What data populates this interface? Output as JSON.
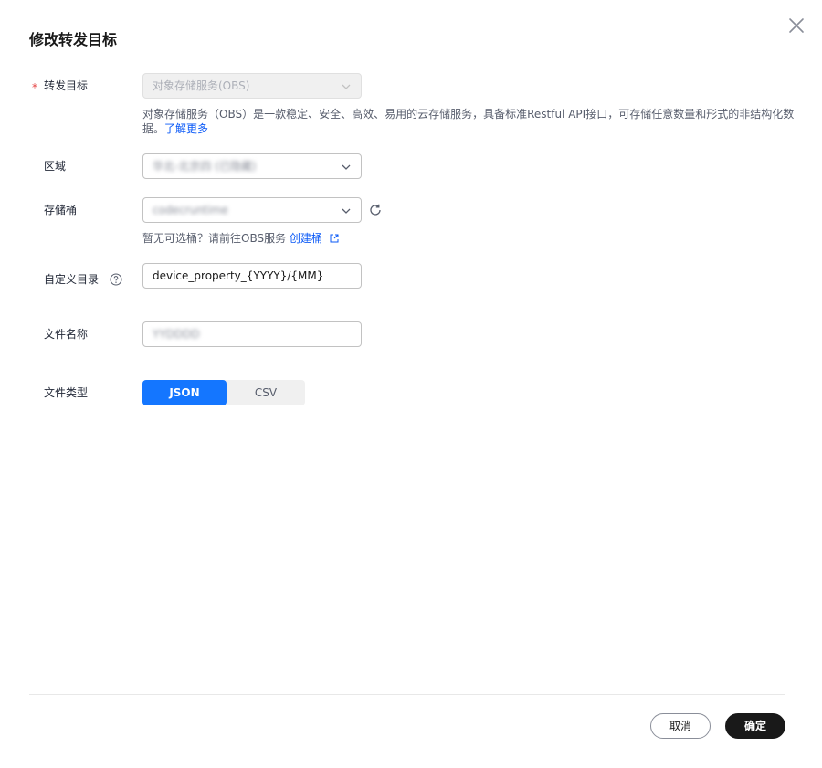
{
  "dialog": {
    "title": "修改转发目标"
  },
  "form": {
    "target": {
      "required_mark": "*",
      "label": "转发目标",
      "value": "对象存储服务(OBS)",
      "description": "对象存储服务（OBS）是一款稳定、安全、高效、易用的云存储服务，具备标准Restful API接口，可存储任意数量和形式的非结构化数据。",
      "learn_more": "了解更多"
    },
    "region": {
      "label": "区域",
      "value": "华北-北京四 (已隐藏)"
    },
    "bucket": {
      "label": "存储桶",
      "value": "codecruntime",
      "hint": "暂无可选桶？请前往OBS服务",
      "create_link": "创建桶"
    },
    "directory": {
      "label": "自定义目录",
      "value": "device_property_{YYYY}/{MM}"
    },
    "filename": {
      "label": "文件名称",
      "value": "YYDDDD"
    },
    "filetype": {
      "label": "文件类型",
      "options": [
        "JSON",
        "CSV"
      ],
      "selected": "JSON"
    }
  },
  "footer": {
    "cancel_label": "取消",
    "ok_label": "确定"
  },
  "colors": {
    "primary": "#1476ff",
    "link": "#0a59f7",
    "required": "#e54545",
    "dark_button": "#191919"
  }
}
